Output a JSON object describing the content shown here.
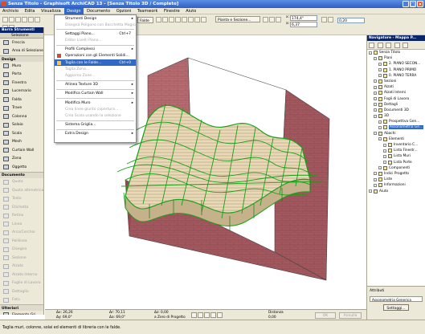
{
  "window": {
    "title": "Senza Titolo - Graphisoft ArchiCAD 13 - [Senza Titolo 3D / Completo]"
  },
  "menubar": [
    "Archivio",
    "Edita",
    "Visualizza",
    "Design",
    "Documento",
    "Opzioni",
    "Teamwork",
    "Finestre",
    "Aiuto"
  ],
  "toolbar": {
    "mode_dropdown": "Pianta e Sezione...",
    "field_a": "174,4°",
    "field_b": "6,37",
    "field_c": "0,20",
    "field_x_label": "x:",
    "field_y_label": "a:",
    "falde_dropdown": "Falde"
  },
  "toolbox": {
    "header": "Barra Strumenti",
    "selection": "Selezione",
    "groups": [
      {
        "label": "",
        "tools": [
          {
            "label": "Freccia",
            "enabled": true
          },
          {
            "label": "Area di Selezione",
            "enabled": true
          }
        ]
      },
      {
        "label": "Design",
        "tools": [
          {
            "label": "Muro",
            "enabled": true
          },
          {
            "label": "Porta",
            "enabled": true
          },
          {
            "label": "Finestra",
            "enabled": true
          },
          {
            "label": "Lucernario",
            "enabled": true
          },
          {
            "label": "Falda",
            "enabled": true
          },
          {
            "label": "Trave",
            "enabled": true
          },
          {
            "label": "Colonna",
            "enabled": true
          },
          {
            "label": "Solaio",
            "enabled": true
          },
          {
            "label": "Scala",
            "enabled": true
          },
          {
            "label": "Mesh",
            "enabled": true
          },
          {
            "label": "Curtain Wall",
            "enabled": true
          },
          {
            "label": "Zona",
            "enabled": true
          },
          {
            "label": "Oggetto",
            "enabled": true
          }
        ]
      },
      {
        "label": "Documento",
        "tools": [
          {
            "label": "Quota",
            "enabled": false
          },
          {
            "label": "Quota altimetrica",
            "enabled": false
          },
          {
            "label": "Testo",
            "enabled": false
          },
          {
            "label": "Etichetta",
            "enabled": false
          },
          {
            "label": "Retino",
            "enabled": false
          },
          {
            "label": "Linea",
            "enabled": false
          },
          {
            "label": "Arco/Cerchio",
            "enabled": false
          },
          {
            "label": "Polilinea",
            "enabled": false
          },
          {
            "label": "Disegno",
            "enabled": false
          },
          {
            "label": "Sezione",
            "enabled": false
          },
          {
            "label": "Alzato",
            "enabled": false
          },
          {
            "label": "Alzato Interno",
            "enabled": false
          },
          {
            "label": "Foglio di Lavoro",
            "enabled": false
          },
          {
            "label": "Dettaglio",
            "enabled": false
          },
          {
            "label": "Foto",
            "enabled": false
          }
        ]
      },
      {
        "label": "Ulteriori",
        "tools": [
          {
            "label": "Elemento Gri...",
            "enabled": true
          },
          {
            "label": "Testo Muro",
            "enabled": true
          },
          {
            "label": "Finestra-d'a...",
            "enabled": true
          }
        ]
      }
    ]
  },
  "design_menu": {
    "items": [
      {
        "label": "Strumenti Design",
        "shortcut": "",
        "submenu": true,
        "enabled": true
      },
      {
        "label": "Disegna Poligono con Bacchetta Magica",
        "shortcut": "",
        "submenu": false,
        "enabled": false
      },
      {
        "sep": true
      },
      {
        "label": "Settaggi Piano...",
        "shortcut": "Ctrl+7",
        "submenu": false,
        "enabled": true
      },
      {
        "label": "Editor Livelli Piano...",
        "shortcut": "",
        "submenu": false,
        "enabled": false
      },
      {
        "sep": true
      },
      {
        "label": "Profili Complessi",
        "shortcut": "",
        "submenu": true,
        "enabled": true
      },
      {
        "label": "Operazioni con gli Elementi Solidi...",
        "shortcut": "",
        "submenu": false,
        "enabled": true
      },
      {
        "label": "Taglia con le Falde...",
        "shortcut": "Ctrl+0",
        "submenu": false,
        "enabled": true,
        "highlight": true
      },
      {
        "label": "Taglia Zona...",
        "shortcut": "",
        "submenu": false,
        "enabled": false
      },
      {
        "label": "Aggiorna Zone...",
        "shortcut": "",
        "submenu": false,
        "enabled": false
      },
      {
        "sep": true
      },
      {
        "label": "Allinea Texture 3D",
        "shortcut": "",
        "submenu": true,
        "enabled": true
      },
      {
        "sep": true
      },
      {
        "label": "Modifica Curtain Wall",
        "shortcut": "",
        "submenu": true,
        "enabled": true
      },
      {
        "sep": true
      },
      {
        "label": "Modifica Muro",
        "shortcut": "",
        "submenu": true,
        "enabled": true
      },
      {
        "label": "Crea linee giunto copertura...",
        "shortcut": "",
        "submenu": false,
        "enabled": false
      },
      {
        "label": "Crea Scala usando la selezione",
        "shortcut": "",
        "submenu": false,
        "enabled": false
      },
      {
        "sep": true
      },
      {
        "label": "Sistema Griglia...",
        "shortcut": "",
        "submenu": false,
        "enabled": true
      },
      {
        "sep": true
      },
      {
        "label": "Extra Design",
        "shortcut": "",
        "submenu": true,
        "enabled": true
      }
    ]
  },
  "navigator": {
    "header": "Navigatore - Mappa P...",
    "tree": [
      {
        "label": "Senza Titolo",
        "indent": 0
      },
      {
        "label": "Piani",
        "indent": 1
      },
      {
        "label": "2. PIANO SECON...",
        "indent": 2
      },
      {
        "label": "1. PIANO PRIMO",
        "indent": 2
      },
      {
        "label": "0. PIANO TERRA",
        "indent": 2
      },
      {
        "label": "Sezioni",
        "indent": 1
      },
      {
        "label": "Alzati",
        "indent": 1
      },
      {
        "label": "Alzati Interni",
        "indent": 1
      },
      {
        "label": "Fogli di Lavoro",
        "indent": 1
      },
      {
        "label": "Dettagli",
        "indent": 1
      },
      {
        "label": "Documenti 3D",
        "indent": 1
      },
      {
        "label": "3D",
        "indent": 1
      },
      {
        "label": "Prospettiva Gen...",
        "indent": 2
      },
      {
        "label": "Assonometria Ge...",
        "indent": 2,
        "highlight": true
      },
      {
        "label": "Abachi",
        "indent": 1
      },
      {
        "label": "Elementi",
        "indent": 2
      },
      {
        "label": "Inventario C...",
        "indent": 3
      },
      {
        "label": "Lista Finestr...",
        "indent": 3
      },
      {
        "label": "Lista Muri",
        "indent": 3
      },
      {
        "label": "Lista Porte",
        "indent": 3
      },
      {
        "label": "Componenti",
        "indent": 2
      },
      {
        "label": "Indici Progetto",
        "indent": 1
      },
      {
        "label": "Liste",
        "indent": 1
      },
      {
        "label": "Informazioni",
        "indent": 1
      },
      {
        "label": "Aiuto",
        "indent": 0
      }
    ],
    "attributes_label": "Attributi",
    "view_label": "Assonometria Generica",
    "settings_button": "Settaggi..."
  },
  "coordbar": {
    "dx": "Δx: 26,26",
    "dy": "Δy: 69,0°",
    "r": "Δr: 70,11",
    "a": "Δa: 69,0°",
    "z": "Δz: 0,00",
    "ref": "a Zero di Progetto",
    "distance_label": "Distanza",
    "distance": "0,00",
    "ok": "OK",
    "cancel": "Annulla"
  },
  "status_text": "Taglia muri, colonne, solai ed elementi di libreria con le falde.",
  "colors": {
    "wall": "#a1585e",
    "roof_stroke": "#19a119",
    "menu_highlight": "#316ac5"
  }
}
